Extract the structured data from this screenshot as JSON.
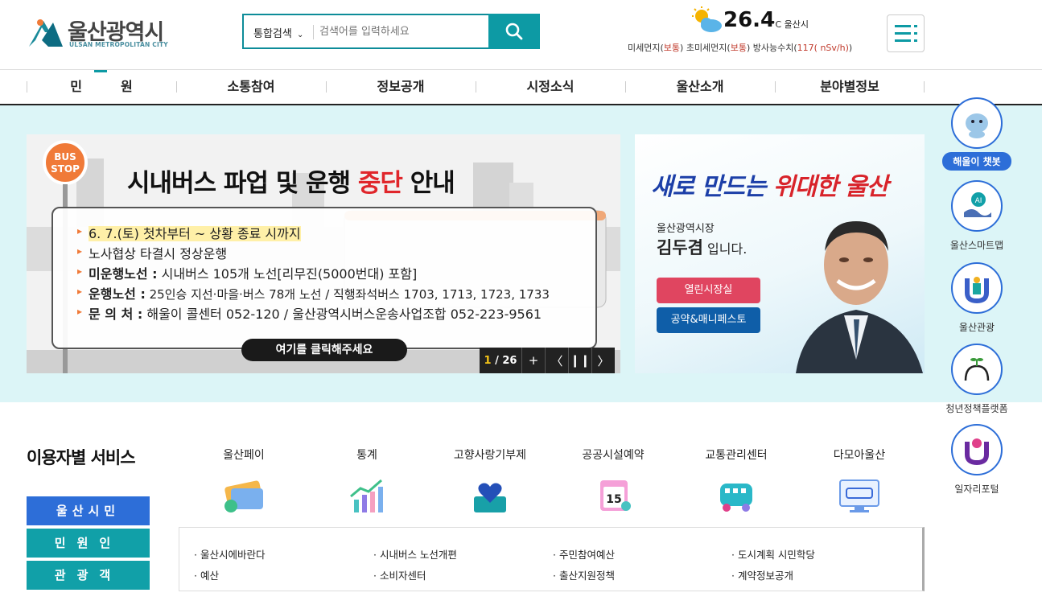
{
  "header": {
    "logo_text": "울산광역시",
    "logo_sub": "ULSAN METROPOLITAN CITY",
    "search_scope": "통합검색",
    "search_placeholder": "검색어를 입력하세요",
    "weather": {
      "temp": "26.4",
      "unit": "°C 울산시",
      "fine_dust_label": "미세먼지(",
      "fine_dust_status": "보통",
      "ultra_dust_label": ") 초미세먼지(",
      "ultra_dust_status": "보통",
      "radiation_label": ") 방사능수치(",
      "radiation_value": "117( nSv/h)",
      "radiation_close": ")"
    }
  },
  "nav": {
    "items": [
      "민　　　원",
      "소통참여",
      "정보공개",
      "시정소식",
      "울산소개",
      "분야별정보"
    ]
  },
  "banner": {
    "bus_stop": "BUS STOP",
    "title_pre": "시내버스 파업 및 운행 ",
    "title_red": "중단",
    "title_post": " 안내",
    "lines": [
      {
        "bold": "",
        "text": "6. 7.(토) 첫차부터 ~ 상황 종료 시까지"
      },
      {
        "bold": "",
        "text": "노사협상 타결시 정상운행"
      },
      {
        "bold": "미운행노선 :",
        "text": " 시내버스 105개 노선[리무진(5000번대) 포함]"
      },
      {
        "bold": "운행노선 :",
        "text": " 25인승 지선·마을·버스 78개 노선 / 직행좌석버스 1703, 1713, 1723, 1733"
      },
      {
        "bold": "문 의 처 :",
        "text": " 해울이 콜센터 052-120 / 울산광역시버스운송사업조합 052-223-9561"
      }
    ],
    "cta": "여기를 클릭해주세요",
    "counter_current": "1",
    "counter_total": "/ 26"
  },
  "mayor": {
    "slogan_a": "새로 만드는 ",
    "slogan_b": "위대한 울산",
    "role": "울산광역시장",
    "name": "김두겸",
    "name_suffix": " 입니다.",
    "button1": "열린시장실",
    "button2": "공약&매니페스토"
  },
  "side": [
    {
      "label": "해울이 챗봇",
      "icon": "chatbot-mascot-icon"
    },
    {
      "label": "울산스마트맵",
      "icon": "smart-map-icon"
    },
    {
      "label": "울산관광",
      "icon": "tourism-icon"
    },
    {
      "label": "청년정책플랫폼",
      "icon": "youth-policy-icon"
    },
    {
      "label": "일자리포털",
      "icon": "job-portal-icon"
    }
  ],
  "services": {
    "title": "이용자별 서비스",
    "tabs": [
      "울산시민",
      "민원인",
      "관광객"
    ],
    "quick": [
      {
        "label": "울산페이",
        "icon": "card-icon"
      },
      {
        "label": "통계",
        "icon": "stats-chart-icon"
      },
      {
        "label": "고향사랑기부제",
        "icon": "heart-donation-icon"
      },
      {
        "label": "공공시설예약",
        "icon": "calendar-icon"
      },
      {
        "label": "교통관리센터",
        "icon": "bus-icon"
      },
      {
        "label": "다모아울산",
        "icon": "monitor-icon"
      }
    ],
    "links": [
      [
        "울산시에바란다",
        "시내버스 노선개편",
        "주민참여예산",
        "도시계획 시민학당"
      ],
      [
        "예산",
        "소비자센터",
        "출산지원정책",
        "계약정보공개"
      ]
    ]
  },
  "colors": {
    "brand": "#0d9aa4",
    "accent_blue": "#2d6ed8",
    "hero_bg": "#dcf5f7"
  }
}
